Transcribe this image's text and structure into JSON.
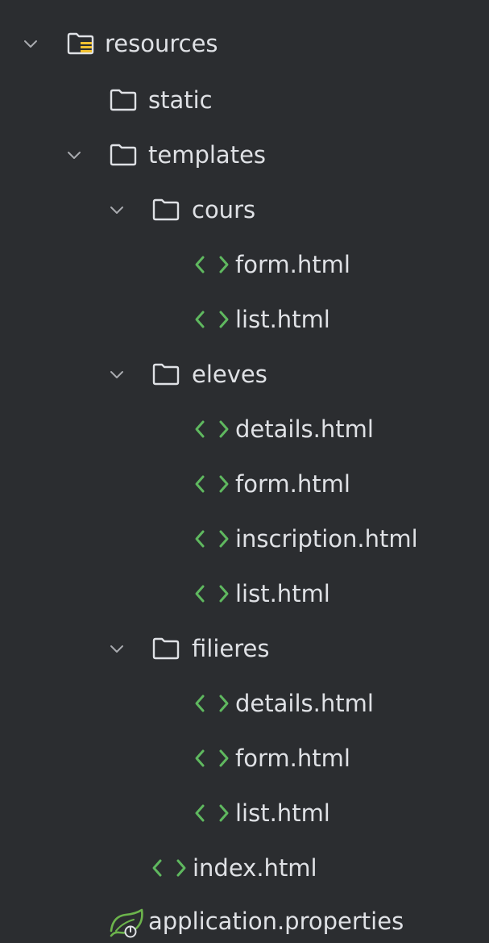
{
  "colors": {
    "background": "#2b2d30",
    "text": "#dfe1e5",
    "chevron": "#a9abb0",
    "folder": "#dfe1e5",
    "html_icon": "#5fb85f",
    "resources_badge": "#f0c030",
    "spring_icon": "#6cb44c"
  },
  "tree": {
    "resources": {
      "label": "resources",
      "expanded": true,
      "icon": "resources-folder-icon"
    },
    "static": {
      "label": "static",
      "icon": "folder-icon"
    },
    "templates": {
      "label": "templates",
      "expanded": true,
      "icon": "folder-icon"
    },
    "cours": {
      "label": "cours",
      "expanded": true,
      "icon": "folder-icon",
      "files": [
        "form.html",
        "list.html"
      ]
    },
    "eleves": {
      "label": "eleves",
      "expanded": true,
      "icon": "folder-icon",
      "files": [
        "details.html",
        "form.html",
        "inscription.html",
        "list.html"
      ]
    },
    "filieres": {
      "label": "filieres",
      "expanded": true,
      "icon": "folder-icon",
      "files": [
        "details.html",
        "form.html",
        "list.html"
      ]
    },
    "index": {
      "label": "index.html",
      "icon": "html-file-icon"
    },
    "application_properties": {
      "label": "application.properties",
      "icon": "spring-properties-icon"
    }
  }
}
